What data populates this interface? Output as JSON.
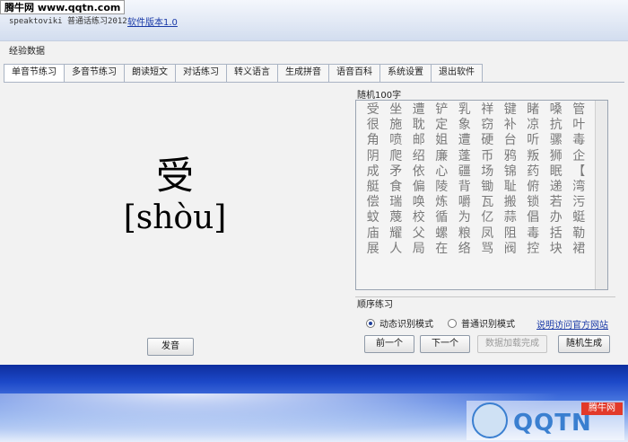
{
  "watermark": "腾牛网 www.qqtn.com",
  "header": {
    "app_title": "speaktoviki 普通话练习2012",
    "version_link": "软件版本1.0"
  },
  "section_label": "经验数据",
  "tabs": [
    {
      "label": "单音节练习",
      "active": true
    },
    {
      "label": "多音节练习",
      "active": false
    },
    {
      "label": "朗读短文",
      "active": false
    },
    {
      "label": "对话练习",
      "active": false
    },
    {
      "label": "转义语言",
      "active": false
    },
    {
      "label": "生成拼音",
      "active": false
    },
    {
      "label": "语音百科",
      "active": false
    },
    {
      "label": "系统设置",
      "active": false
    },
    {
      "label": "退出软件",
      "active": false
    }
  ],
  "practice": {
    "character": "受",
    "pinyin": "[shòu]",
    "pronounce_button": "发音"
  },
  "random_chars": {
    "title": "随机100字",
    "chars": [
      "受",
      "坐",
      "遭",
      "铲",
      "乳",
      "祥",
      "键",
      "睹",
      "嗓",
      "管",
      "很",
      "施",
      "耽",
      "定",
      "象",
      "窃",
      "补",
      "凉",
      "抗",
      "叶",
      "角",
      "喷",
      "邮",
      "姐",
      "遭",
      "硬",
      "台",
      "听",
      "骡",
      "毒",
      "阴",
      "爬",
      "绍",
      "廉",
      "蓬",
      "币",
      "鸦",
      "叛",
      "狮",
      "企",
      "成",
      "矛",
      "依",
      "心",
      "疆",
      "场",
      "锦",
      "药",
      "眠",
      "【",
      "艇",
      "食",
      "偏",
      "陵",
      "背",
      "锄",
      "耻",
      "俯",
      "递",
      "湾",
      "偿",
      "瑞",
      "唤",
      "炼",
      "嚼",
      "瓦",
      "搬",
      "锁",
      "若",
      "污",
      "蚊",
      "蔑",
      "校",
      "循",
      "为",
      "亿",
      "蒜",
      "倡",
      "办",
      "蜓",
      "庙",
      "耀",
      "父",
      "螺",
      "粮",
      "凤",
      "阻",
      "毒",
      "括",
      "勒",
      "展",
      "人",
      "局",
      "在",
      "络",
      "骂",
      "阀",
      "控",
      "块",
      "裙"
    ]
  },
  "sequence": {
    "title": "顺序练习",
    "mode_dynamic": "动态识别模式",
    "mode_normal": "普通识别模式",
    "selected_mode": "动态识别模式",
    "visit_link": "说明访问官方网站",
    "prev_button": "前一个",
    "next_button": "下一个",
    "load_button": "数据加载完成",
    "random_button": "随机生成"
  },
  "footer": {
    "logo_text": "QQTN",
    "badge": "腾牛网"
  }
}
